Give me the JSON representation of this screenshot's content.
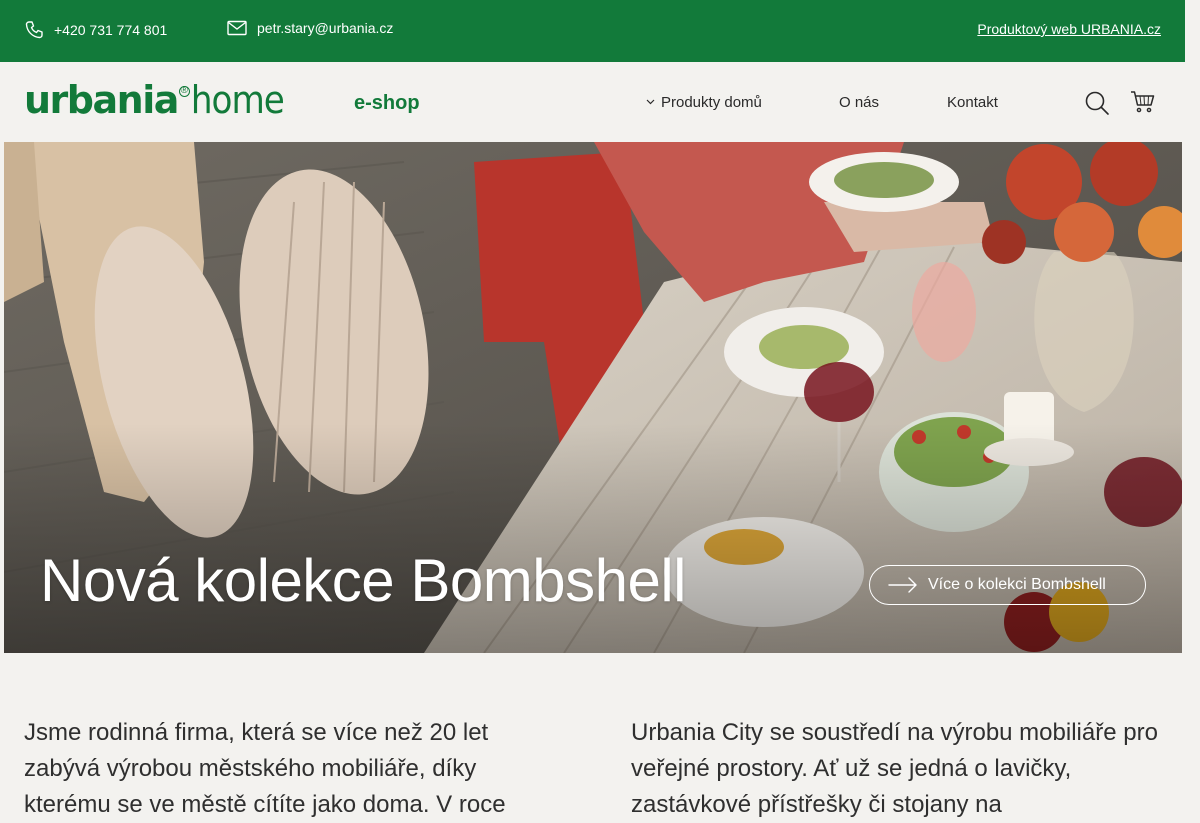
{
  "topbar": {
    "phone": "+420 731 774 801",
    "email": "petr.stary@urbania.cz",
    "product_link": "Produktový web URBANIA.cz"
  },
  "header": {
    "logo_brand": "urbania",
    "logo_suffix": "home",
    "eshop": "e-shop",
    "nav": {
      "products": "Produkty domů",
      "about": "O nás",
      "contact": "Kontakt"
    }
  },
  "hero": {
    "title": "Nová kolekce Bombshell",
    "cta": "Více o kolekci Bombshell"
  },
  "content": {
    "left": "Jsme rodinná firma, která se více než 20 let zabývá výrobou městského mobiliáře, díky kterému se ve městě cítíte jako doma. V roce",
    "right": "Urbania City se soustředí na výrobu mobiliáře pro veřejné prostory. Ať už se jedná o lavičky, zastávkové přístřešky či stojany na"
  },
  "colors": {
    "brand": "#127a3a",
    "background": "#f3f2ef"
  }
}
